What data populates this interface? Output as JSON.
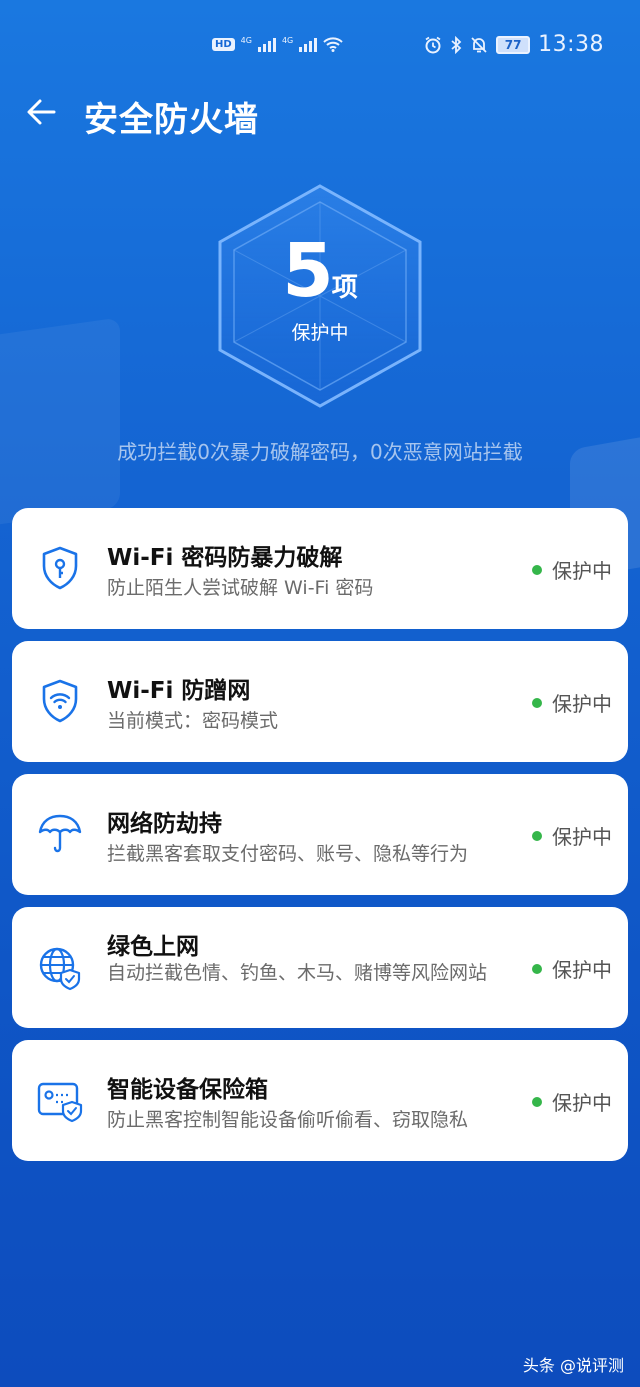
{
  "status_bar": {
    "hd_label": "HD",
    "net_a": "4G",
    "net_b": "4G",
    "battery": "77",
    "time": "13:38"
  },
  "header": {
    "back_icon": "arrow-left-icon",
    "title": "安全防火墙"
  },
  "emblem": {
    "count": "5",
    "unit": "项",
    "status": "保护中"
  },
  "summary": "成功拦截0次暴力破解密码，0次恶意网站拦截",
  "colors": {
    "background": "#1464d2",
    "card": "#ffffff",
    "status_dot": "#35b64a",
    "icon": "#1a73e8"
  },
  "cards": [
    {
      "icon": "shield-key-icon",
      "title": "Wi-Fi 密码防暴力破解",
      "desc": "防止陌生人尝试破解 Wi-Fi 密码",
      "status": "保护中"
    },
    {
      "icon": "shield-wifi-icon",
      "title": "Wi-Fi 防蹭网",
      "desc": "当前模式：密码模式",
      "status": "保护中"
    },
    {
      "icon": "umbrella-icon",
      "title": "网络防劫持",
      "desc": "拦截黑客套取支付密码、账号、隐私等行为",
      "status": "保护中"
    },
    {
      "icon": "globe-shield-icon",
      "title": "绿色上网",
      "desc": "自动拦截色情、钓鱼、木马、赌博等风险网站",
      "status": "保护中"
    },
    {
      "icon": "device-safe-icon",
      "title": "智能设备保险箱",
      "desc": "防止黑客控制智能设备偷听偷看、窃取隐私",
      "status": "保护中"
    }
  ],
  "watermark": "头条 @说评测"
}
